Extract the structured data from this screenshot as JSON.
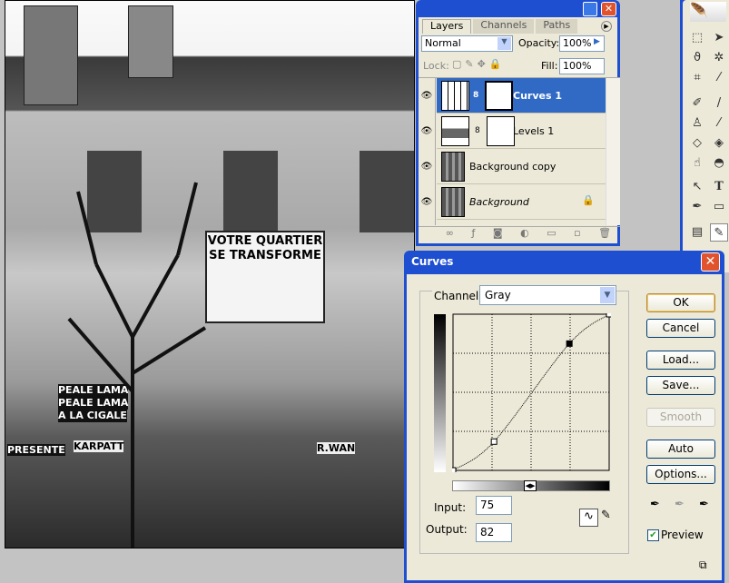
{
  "photo": {
    "poster_line1": "VOTRE QUARTIER",
    "poster_line2": "SE TRANSFORME",
    "posters": [
      "PEALE LAMA",
      "PEALE LAMA",
      "KARPATT",
      "R.WAN",
      "PRESENTE",
      "A LA CIGALE"
    ]
  },
  "layers_panel": {
    "tabs": [
      "Layers",
      "Channels",
      "Paths"
    ],
    "active_tab": "Layers",
    "blend_mode": "Normal",
    "opacity_label": "Opacity:",
    "opacity": "100%",
    "lock_label": "Lock:",
    "fill_label": "Fill:",
    "fill": "100%",
    "layers": [
      {
        "name": "Curves 1",
        "selected": true,
        "type": "curves"
      },
      {
        "name": "Levels 1",
        "selected": false,
        "type": "levels"
      },
      {
        "name": "Background copy",
        "selected": false,
        "type": "image"
      },
      {
        "name": "Background",
        "selected": false,
        "type": "image",
        "locked": true
      }
    ]
  },
  "curves": {
    "title": "Curves",
    "channel_label": "Channel:",
    "channel": "Gray",
    "input_label": "Input:",
    "input": "75",
    "output_label": "Output:",
    "output": "82",
    "buttons": {
      "ok": "OK",
      "cancel": "Cancel",
      "load": "Load...",
      "save": "Save...",
      "smooth": "Smooth",
      "auto": "Auto",
      "options": "Options..."
    },
    "preview_label": "Preview",
    "preview_checked": true,
    "points": [
      [
        0,
        0
      ],
      [
        67,
        47
      ],
      [
        190,
        207
      ],
      [
        255,
        255
      ]
    ]
  },
  "colors": {
    "xp_blue": "#1f4fd1",
    "selection": "#316ac5",
    "face": "#ece9d8"
  }
}
